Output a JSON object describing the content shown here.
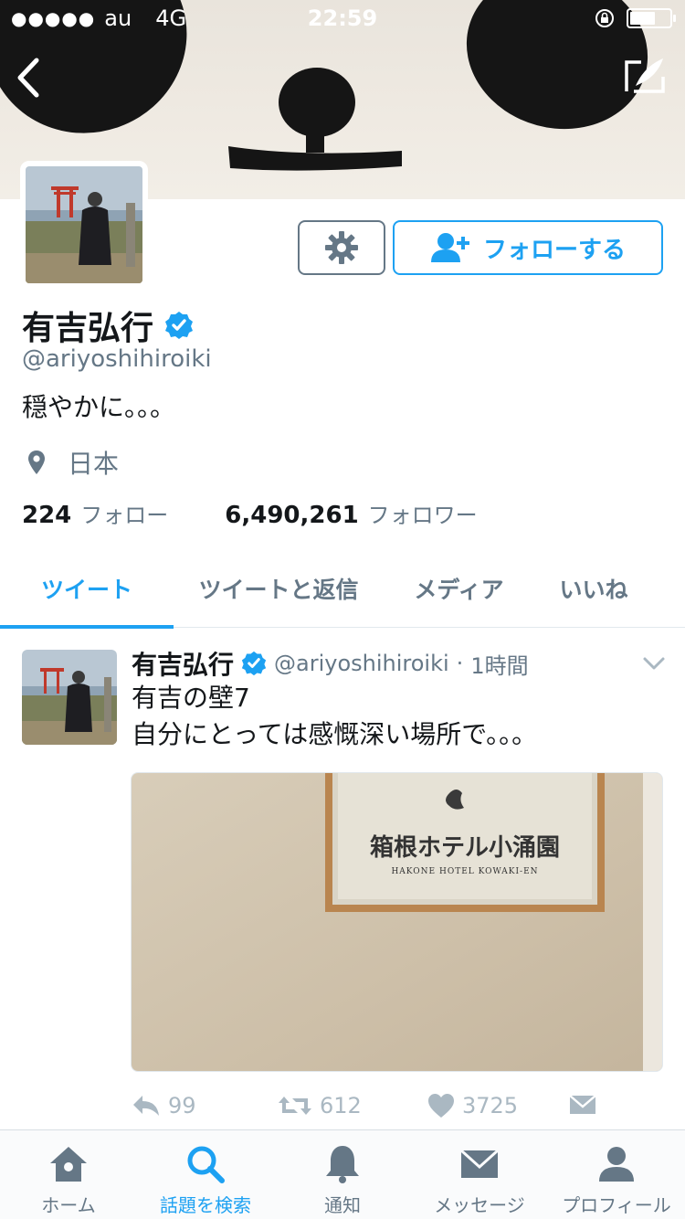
{
  "status_bar": {
    "carrier": "au",
    "network": "4G",
    "time": "22:59",
    "battery_level": 0.65
  },
  "header": {
    "back_icon": "chevron-left-icon",
    "compose_icon": "compose-quill-icon"
  },
  "profile": {
    "name": "有吉弘行",
    "verified": true,
    "handle": "@ariyoshihiroiki",
    "bio": "穏やかに。。。",
    "location": "日本",
    "following_count": "224",
    "following_label": "フォロー",
    "followers_count": "6,490,261",
    "followers_label": "フォロワー",
    "follow_button_label": "フォローする",
    "settings_icon": "gear-icon"
  },
  "tabs": [
    {
      "label": "ツイート",
      "active": true
    },
    {
      "label": "ツイートと返信",
      "active": false
    },
    {
      "label": "メディア",
      "active": false
    },
    {
      "label": "いいね",
      "active": false
    }
  ],
  "tweet": {
    "author_name": "有吉弘行",
    "author_handle": "@ariyoshihiroiki",
    "separator": "·",
    "time": "1時間",
    "line1": "有吉の壁7",
    "line2": "自分にとっては感慨深い場所で。。。",
    "media_sign_jp": "箱根ホテル小涌園",
    "media_sign_en": "HAKONE HOTEL KOWAKI-EN",
    "replies": "99",
    "retweets": "612",
    "likes": "3725"
  },
  "bottom_nav": [
    {
      "label": "ホーム",
      "icon": "home-icon",
      "active": false
    },
    {
      "label": "話題を検索",
      "icon": "search-icon",
      "active": true
    },
    {
      "label": "通知",
      "icon": "bell-icon",
      "active": false
    },
    {
      "label": "メッセージ",
      "icon": "envelope-icon",
      "active": false
    },
    {
      "label": "プロフィール",
      "icon": "person-icon",
      "active": false
    }
  ],
  "colors": {
    "accent": "#1da1f2",
    "secondary_text": "#657786",
    "action_icons": "#aab8c2"
  }
}
